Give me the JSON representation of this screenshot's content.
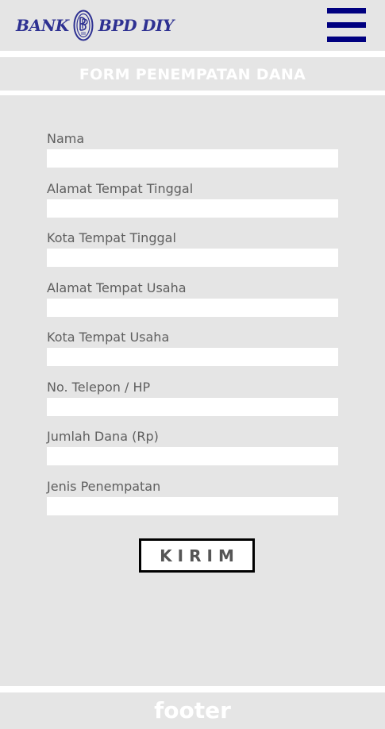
{
  "header": {
    "logo_left": "BANK",
    "logo_right": "BPD DIY",
    "brand_color": "#2e3192",
    "menu_icon": "hamburger-menu-icon",
    "menu_color": "#000080"
  },
  "form": {
    "title": "FORM PENEMPATAN DANA",
    "fields": [
      {
        "label": "Nama",
        "value": "",
        "placeholder": ""
      },
      {
        "label": "Alamat Tempat Tinggal",
        "value": "",
        "placeholder": ""
      },
      {
        "label": "Kota Tempat Tinggal",
        "value": "",
        "placeholder": ""
      },
      {
        "label": "Alamat Tempat Usaha",
        "value": "",
        "placeholder": ""
      },
      {
        "label": "Kota Tempat Usaha",
        "value": "",
        "placeholder": ""
      },
      {
        "label": "No. Telepon / HP",
        "value": "",
        "placeholder": ""
      },
      {
        "label": "Jumlah Dana (Rp)",
        "value": "",
        "placeholder": ""
      },
      {
        "label": "Jenis Penempatan",
        "value": "",
        "placeholder": ""
      }
    ],
    "submit_label": "KIRIM"
  },
  "footer": {
    "text": "footer"
  },
  "colors": {
    "panel": "#e5e5e5",
    "label_text": "#5f5f5f"
  }
}
